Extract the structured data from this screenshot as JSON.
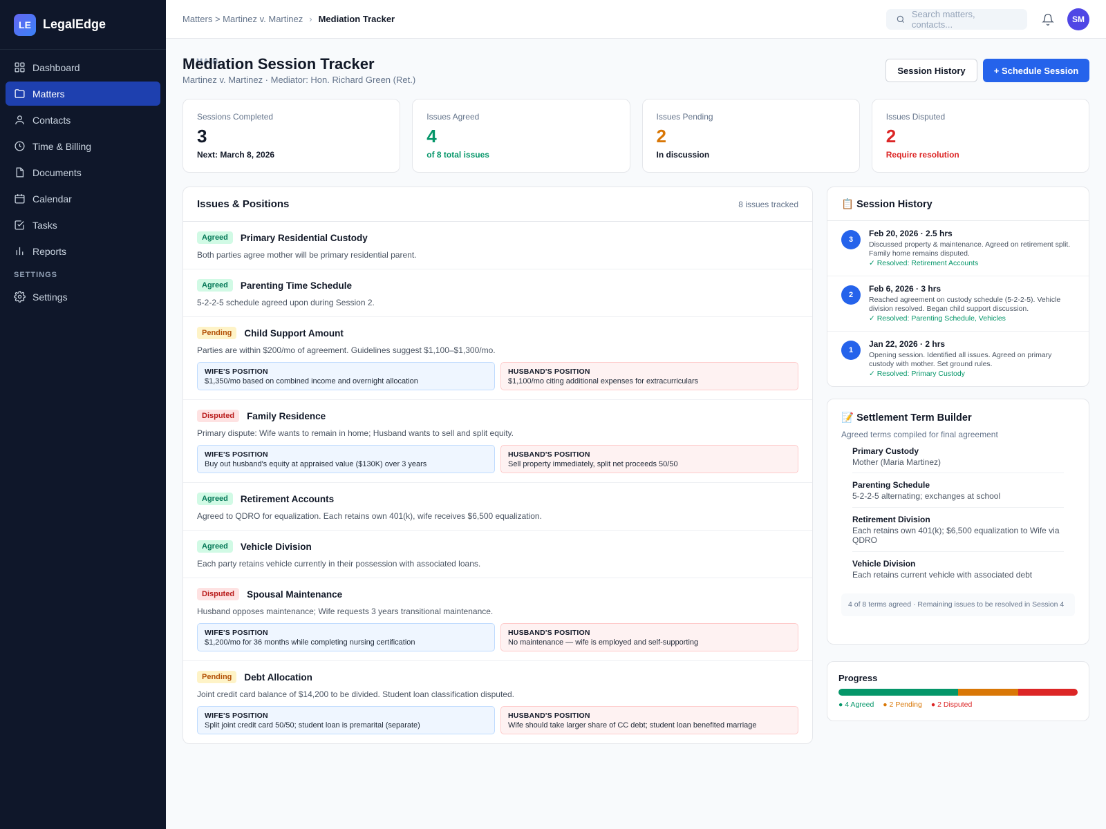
{
  "app": {
    "logo": "LE",
    "name": "LegalEdge"
  },
  "sidebar": {
    "main_section": "MAIN",
    "items": [
      {
        "label": "Dashboard",
        "icon": "grid-icon"
      },
      {
        "label": "Matters",
        "icon": "folder-icon",
        "active": true
      },
      {
        "label": "Contacts",
        "icon": "user-icon"
      },
      {
        "label": "Time & Billing",
        "icon": "clock-icon"
      },
      {
        "label": "Documents",
        "icon": "document-icon"
      },
      {
        "label": "Calendar",
        "icon": "calendar-icon"
      },
      {
        "label": "Tasks",
        "icon": "check-square-icon"
      },
      {
        "label": "Reports",
        "icon": "bar-chart-icon"
      }
    ],
    "settings_section": "SETTINGS",
    "settings_item": {
      "label": "Settings",
      "icon": "gear-icon"
    }
  },
  "topbar": {
    "breadcrumb_parent": "Matters > Martinez v. Martinez",
    "breadcrumb_sep": "›",
    "breadcrumb_current": "Mediation Tracker",
    "search_placeholder": "Search matters, contacts...",
    "avatar": "SM"
  },
  "page": {
    "title": "Mediation Session Tracker",
    "subtitle": "Martinez v. Martinez · Mediator: Hon. Richard Green (Ret.)",
    "btn_history": "Session History",
    "btn_schedule": "+ Schedule Session"
  },
  "stats": [
    {
      "label": "Sessions Completed",
      "value": "3",
      "foot": "Next: March 8, 2026",
      "color": "#111827",
      "foot_color": "#111827"
    },
    {
      "label": "Issues Agreed",
      "value": "4",
      "foot": "of 8 total issues",
      "color": "#059669",
      "foot_color": "#059669"
    },
    {
      "label": "Issues Pending",
      "value": "2",
      "foot": "In discussion",
      "color": "#d97706",
      "foot_color": "#111827"
    },
    {
      "label": "Issues Disputed",
      "value": "2",
      "foot": "Require resolution",
      "color": "#dc2626",
      "foot_color": "#dc2626"
    }
  ],
  "issues": {
    "title": "Issues & Positions",
    "count": "8 issues tracked",
    "wife_label": "WIFE'S POSITION",
    "husband_label": "HUSBAND'S POSITION",
    "list": [
      {
        "status": "Agreed",
        "kind": "agreed",
        "name": "Primary Residential Custody",
        "desc": "Both parties agree mother will be primary residential parent."
      },
      {
        "status": "Agreed",
        "kind": "agreed",
        "name": "Parenting Time Schedule",
        "desc": "5-2-2-5 schedule agreed upon during Session 2."
      },
      {
        "status": "Pending",
        "kind": "pending",
        "name": "Child Support Amount",
        "desc": "Parties are within $200/mo of agreement. Guidelines suggest $1,100–$1,300/mo.",
        "wife": "$1,350/mo based on combined income and overnight allocation",
        "husband": "$1,100/mo citing additional expenses for extracurriculars"
      },
      {
        "status": "Disputed",
        "kind": "disputed",
        "name": "Family Residence",
        "desc": "Primary dispute: Wife wants to remain in home; Husband wants to sell and split equity.",
        "wife": "Buy out husband's equity at appraised value ($130K) over 3 years",
        "husband": "Sell property immediately, split net proceeds 50/50"
      },
      {
        "status": "Agreed",
        "kind": "agreed",
        "name": "Retirement Accounts",
        "desc": "Agreed to QDRO for equalization. Each retains own 401(k), wife receives $6,500 equalization."
      },
      {
        "status": "Agreed",
        "kind": "agreed",
        "name": "Vehicle Division",
        "desc": "Each party retains vehicle currently in their possession with associated loans."
      },
      {
        "status": "Disputed",
        "kind": "disputed",
        "name": "Spousal Maintenance",
        "desc": "Husband opposes maintenance; Wife requests 3 years transitional maintenance.",
        "wife": "$1,200/mo for 36 months while completing nursing certification",
        "husband": "No maintenance — wife is employed and self-supporting"
      },
      {
        "status": "Pending",
        "kind": "pending",
        "name": "Debt Allocation",
        "desc": "Joint credit card balance of $14,200 to be divided. Student loan classification disputed.",
        "wife": "Split joint credit card 50/50; student loan is premarital (separate)",
        "husband": "Wife should take larger share of CC debt; student loan benefited marriage"
      }
    ]
  },
  "session_history": {
    "title": "📋 Session History",
    "sessions": [
      {
        "num": "3",
        "date": "Feb 20, 2026 · 2.5 hrs",
        "desc": "Discussed property & maintenance. Agreed on retirement split. Family home remains disputed.",
        "resolved": "✓ Resolved: Retirement Accounts"
      },
      {
        "num": "2",
        "date": "Feb 6, 2026 · 3 hrs",
        "desc": "Reached agreement on custody schedule (5-2-2-5). Vehicle division resolved. Began child support discussion.",
        "resolved": "✓ Resolved: Parenting Schedule, Vehicles"
      },
      {
        "num": "1",
        "date": "Jan 22, 2026 · 2 hrs",
        "desc": "Opening session. Identified all issues. Agreed on primary custody with mother. Set ground rules.",
        "resolved": "✓ Resolved: Primary Custody"
      }
    ]
  },
  "settlement": {
    "title": "📝 Settlement Term Builder",
    "subtitle": "Agreed terms compiled for final agreement",
    "terms": [
      {
        "title": "Primary Custody",
        "text": "Mother (Maria Martinez)"
      },
      {
        "title": "Parenting Schedule",
        "text": "5-2-2-5 alternating; exchanges at school"
      },
      {
        "title": "Retirement Division",
        "text": "Each retains own 401(k); $6,500 equalization to Wife via QDRO"
      },
      {
        "title": "Vehicle Division",
        "text": "Each retains current vehicle with associated debt"
      }
    ],
    "note": "4 of 8 terms agreed · Remaining issues to be resolved in Session 4"
  },
  "progress": {
    "title": "Progress",
    "segments": [
      {
        "label": "● 4 Agreed",
        "count": 4,
        "color": "#059669"
      },
      {
        "label": "● 2 Pending",
        "count": 2,
        "color": "#d97706"
      },
      {
        "label": "● 2 Disputed",
        "count": 2,
        "color": "#dc2626"
      }
    ]
  }
}
